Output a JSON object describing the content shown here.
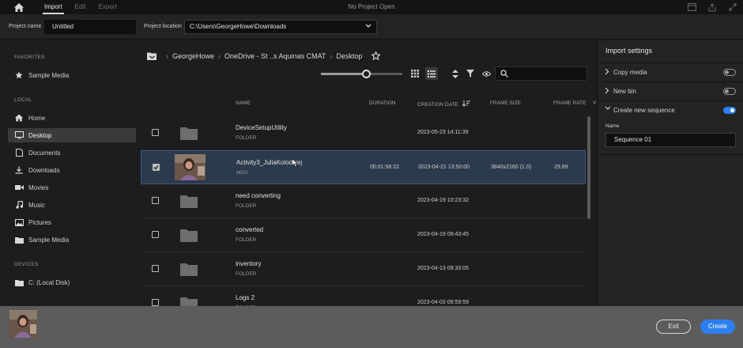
{
  "topbar": {
    "tabs": [
      "Import",
      "Edit",
      "Export"
    ],
    "active_tab": "Import",
    "title": "No Project Open"
  },
  "project": {
    "name_label": "Project name",
    "name_value": "Untitled",
    "location_label": "Project location",
    "location_value": "C:\\Users\\GeorgeHowe\\Downloads"
  },
  "sidebar": {
    "favorites_heading": "FAVORITES",
    "favorites": [
      {
        "label": "Sample Media",
        "icon": "star-icon"
      }
    ],
    "local_heading": "LOCAL",
    "local": [
      {
        "label": "Home",
        "icon": "home-icon"
      },
      {
        "label": "Desktop",
        "icon": "monitor-icon",
        "active": true
      },
      {
        "label": "Documents",
        "icon": "document-icon"
      },
      {
        "label": "Downloads",
        "icon": "download-icon"
      },
      {
        "label": "Movies",
        "icon": "video-icon"
      },
      {
        "label": "Music",
        "icon": "music-icon"
      },
      {
        "label": "Pictures",
        "icon": "image-icon"
      },
      {
        "label": "Sample Media",
        "icon": "folder-icon"
      }
    ],
    "devices_heading": "DEVICES",
    "devices": [
      {
        "label": "C: (Local Disk)",
        "icon": "folder-icon"
      }
    ]
  },
  "breadcrumb": [
    "GeorgeHowe",
    "OneDrive - St ..s Aquinas CMAT",
    "Desktop"
  ],
  "columns": {
    "name": "NAME",
    "duration": "DURATION",
    "creation_date": "CREATION DATE",
    "frame_size": "FRAME SIZE",
    "frame_rate": "FRAME RATE"
  },
  "files": [
    {
      "name": "DeviceSetupUtility",
      "type": "FOLDER",
      "duration": "",
      "date": "2023-05-23 14:11:39",
      "frame_size": "",
      "frame_rate": "",
      "checked": false,
      "is_video": false
    },
    {
      "name": "Activity3_JuliaKolodziej",
      "type": "MOV",
      "duration": "00:01:58:22",
      "date": "2023-04-21 13:50:00",
      "frame_size": "3840x2160 (1.0)",
      "frame_rate": "29.89",
      "checked": true,
      "is_video": true
    },
    {
      "name": "need converting",
      "type": "FOLDER",
      "duration": "",
      "date": "2023-04-19 10:23:32",
      "frame_size": "",
      "frame_rate": "",
      "checked": false,
      "is_video": false
    },
    {
      "name": "converted",
      "type": "FOLDER",
      "duration": "",
      "date": "2023-04-19 09:43:45",
      "frame_size": "",
      "frame_rate": "",
      "checked": false,
      "is_video": false
    },
    {
      "name": "inventory",
      "type": "FOLDER",
      "duration": "",
      "date": "2023-04-13 09:33:05",
      "frame_size": "",
      "frame_rate": "",
      "checked": false,
      "is_video": false
    },
    {
      "name": "Logs 2",
      "type": "FOLDER",
      "duration": "",
      "date": "2023-04-03 09:59:59",
      "frame_size": "",
      "frame_rate": "",
      "checked": false,
      "is_video": false
    }
  ],
  "import_settings": {
    "title": "Import settings",
    "copy_media": {
      "label": "Copy media",
      "on": false
    },
    "new_bin": {
      "label": "New bin",
      "on": false
    },
    "create_sequence": {
      "label": "Create new sequence",
      "on": true
    },
    "name_label": "Name",
    "name_value": "Sequence 01"
  },
  "buttons": {
    "exit": "Exit",
    "create": "Create"
  },
  "thumbnail_zoom": 0.55,
  "colors": {
    "accent": "#2d7ff0",
    "selection": "#2b3a4d"
  }
}
